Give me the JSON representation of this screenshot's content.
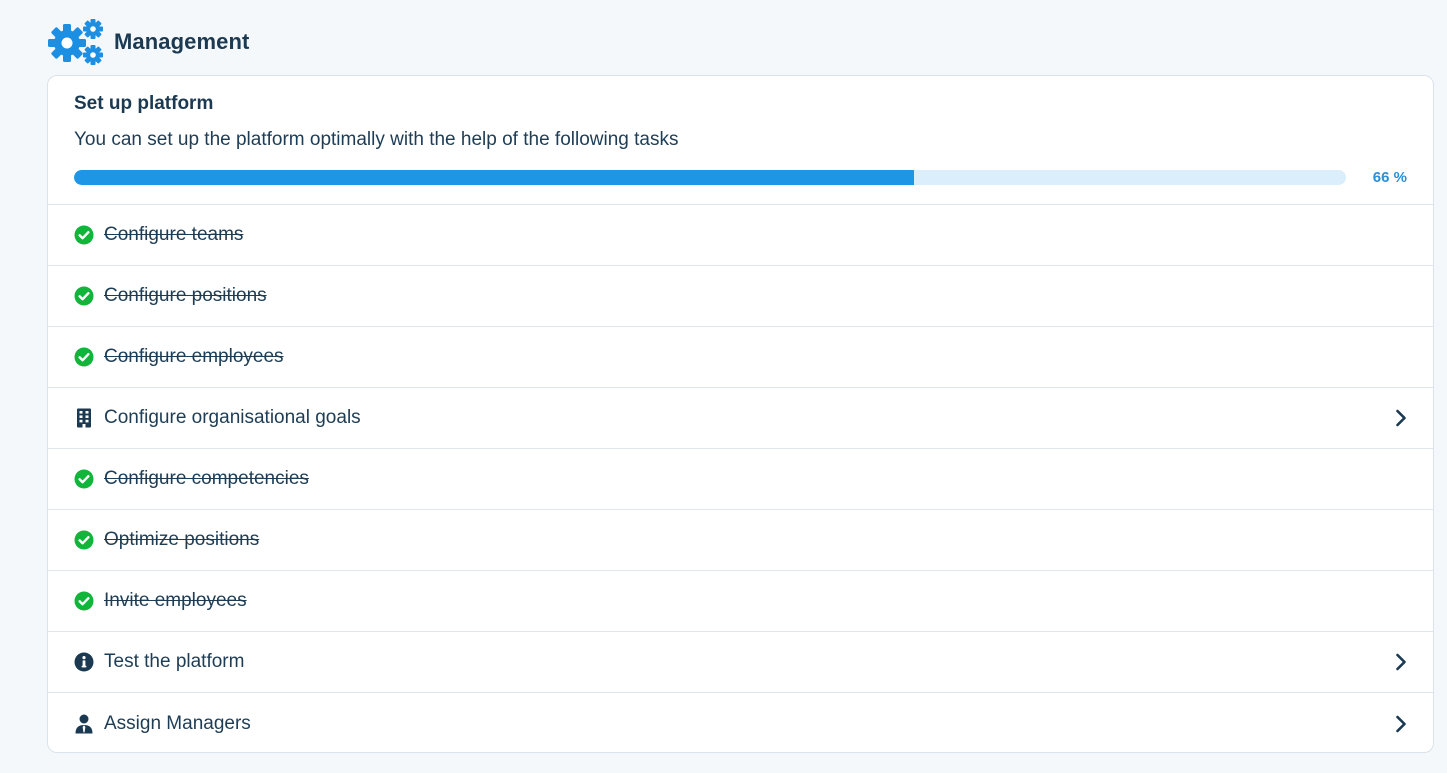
{
  "header": {
    "title": "Management",
    "icon": "gears-icon",
    "accent_color": "#1d8fe3"
  },
  "setup": {
    "title": "Set up platform",
    "subtitle": "You can set up the platform optimally with the help of the following tasks",
    "progress": {
      "percent": 66,
      "label": "66 %"
    }
  },
  "tasks": [
    {
      "label": "Configure teams",
      "status": "done",
      "icon": "check-circle-icon"
    },
    {
      "label": "Configure positions",
      "status": "done",
      "icon": "check-circle-icon"
    },
    {
      "label": "Configure employees",
      "status": "done",
      "icon": "check-circle-icon"
    },
    {
      "label": "Configure organisational goals",
      "status": "pending",
      "icon": "building-icon"
    },
    {
      "label": "Configure competencies",
      "status": "done",
      "icon": "check-circle-icon"
    },
    {
      "label": "Optimize positions",
      "status": "done",
      "icon": "check-circle-icon"
    },
    {
      "label": "Invite employees",
      "status": "done",
      "icon": "check-circle-icon"
    },
    {
      "label": "Test the platform",
      "status": "pending",
      "icon": "info-circle-icon"
    },
    {
      "label": "Assign Managers",
      "status": "pending",
      "icon": "user-tie-icon"
    }
  ],
  "colors": {
    "done_green": "#11b53a",
    "progress_fill": "#1d96e6",
    "progress_track": "#dbeefb",
    "text_dark": "#1b3a52"
  }
}
